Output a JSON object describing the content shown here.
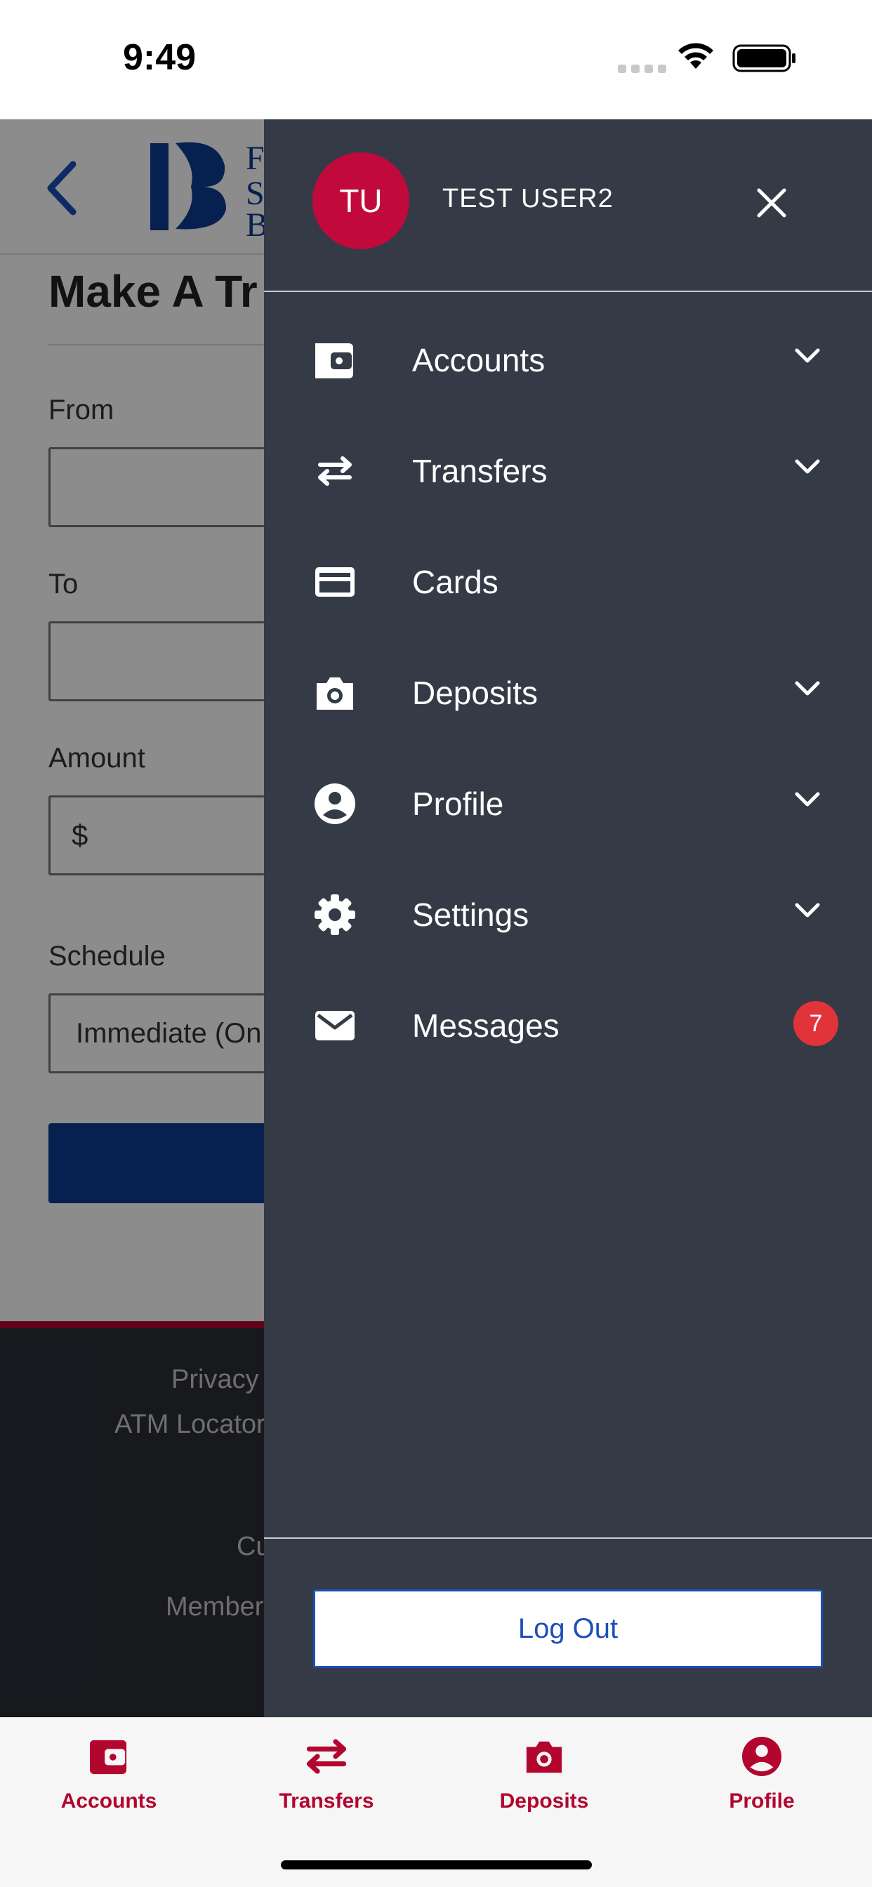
{
  "status_bar": {
    "time": "9:49"
  },
  "background_page": {
    "title": "Make A Tr",
    "from_label": "From",
    "to_label": "To",
    "amount_label": "Amount",
    "amount_prefix": "$",
    "schedule_label": "Schedule",
    "schedule_value": "Immediate (On",
    "footer_lines": [
      "Privacy",
      "ATM Locator",
      "Cu",
      "Member"
    ]
  },
  "drawer": {
    "avatar_initials": "TU",
    "user_name": "TEST USER2",
    "items": [
      {
        "label": "Accounts",
        "icon": "wallet-icon",
        "expandable": true
      },
      {
        "label": "Transfers",
        "icon": "transfer-arrows-icon",
        "expandable": true
      },
      {
        "label": "Cards",
        "icon": "credit-card-icon",
        "expandable": false
      },
      {
        "label": "Deposits",
        "icon": "camera-icon",
        "expandable": true
      },
      {
        "label": "Profile",
        "icon": "user-circle-icon",
        "expandable": true
      },
      {
        "label": "Settings",
        "icon": "gear-icon",
        "expandable": true
      },
      {
        "label": "Messages",
        "icon": "envelope-icon",
        "expandable": false,
        "badge": "7"
      }
    ],
    "logout_label": "Log Out"
  },
  "tab_bar": {
    "tabs": [
      {
        "label": "Accounts",
        "icon": "wallet-icon"
      },
      {
        "label": "Transfers",
        "icon": "transfer-arrows-icon"
      },
      {
        "label": "Deposits",
        "icon": "camera-icon"
      },
      {
        "label": "Profile",
        "icon": "user-circle-icon"
      }
    ]
  },
  "colors": {
    "drawer_bg": "#343b46",
    "brand_red": "#b3062f",
    "avatar_bg": "#c1093c",
    "badge_bg": "#e0343a",
    "primary_blue": "#0b3d91",
    "logout_blue": "#1c4fb8"
  }
}
